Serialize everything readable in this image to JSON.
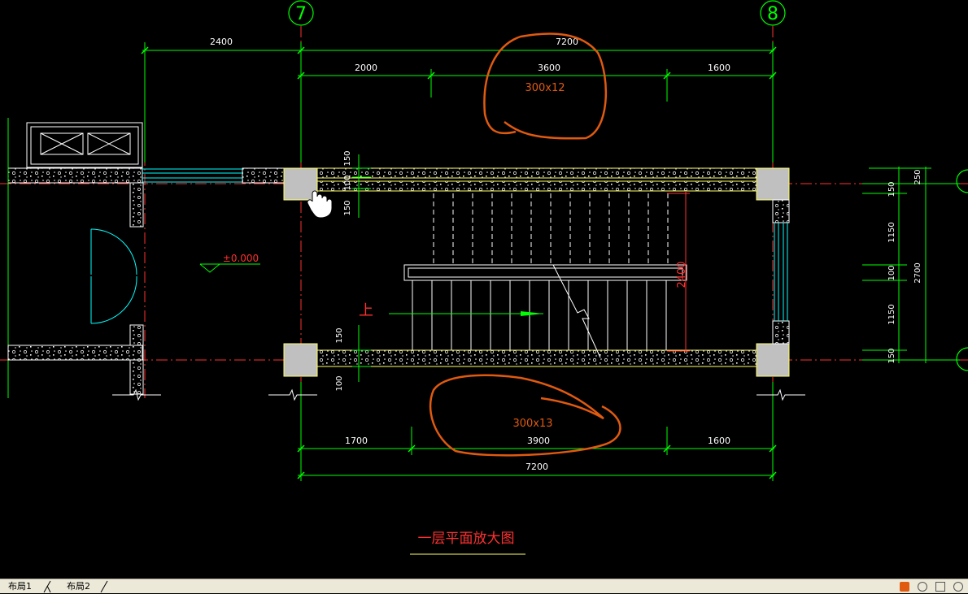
{
  "drawing": {
    "axes": [
      {
        "label": "7"
      },
      {
        "label": "8"
      }
    ],
    "top_dims": {
      "left_span": "2400",
      "overall": "7200",
      "seg1": "2000",
      "seg2": "3600",
      "seg3": "1600"
    },
    "bottom_dims": {
      "seg1": "1700",
      "seg2": "3900",
      "seg3": "1600",
      "overall": "7200"
    },
    "right_dims": {
      "top": "250",
      "a": "150",
      "b": "1150",
      "c": "100",
      "d": "1150",
      "e": "150",
      "overall": "2700"
    },
    "wall_dims": {
      "upper_150": "150",
      "upper_100": "100",
      "upper_150b": "150",
      "lower_150": "150",
      "lower_100": "100"
    },
    "stair_length": "2400",
    "elevation": "±0.000",
    "up_label": "上",
    "annotations": {
      "top_steps": "300x12",
      "bottom_steps": "300x13"
    },
    "drawing_title": "一层平面放大图"
  },
  "colors": {
    "background": "#000000",
    "dim_line": "#00ff00",
    "axis_line": "#ff0000",
    "wall": "#ffff66",
    "markup": "#e05a10",
    "window": "#00ffff",
    "text": "#ffffff"
  },
  "layout_tabs": [
    {
      "label": "布局1"
    },
    {
      "label": "布局2"
    }
  ]
}
